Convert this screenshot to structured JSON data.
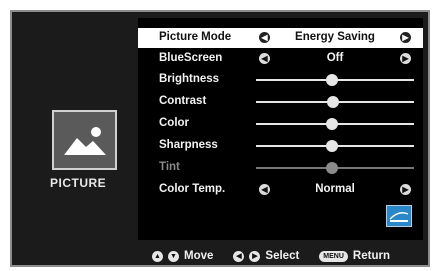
{
  "category": {
    "label": "PICTURE",
    "icon": "picture-icon"
  },
  "menu": {
    "rows": [
      {
        "label": "Picture Mode",
        "type": "selector",
        "value": "Energy Saving",
        "selected": true
      },
      {
        "label": "BlueScreen",
        "type": "selector",
        "value": "Off"
      },
      {
        "label": "Brightness",
        "type": "slider",
        "level": 0.48
      },
      {
        "label": "Contrast",
        "type": "slider",
        "level": 0.49
      },
      {
        "label": "Color",
        "type": "slider",
        "level": 0.48
      },
      {
        "label": "Sharpness",
        "type": "slider",
        "level": 0.48
      },
      {
        "label": "Tint",
        "type": "slider",
        "level": 0.48,
        "disabled": true
      },
      {
        "label": "Color Temp.",
        "type": "selector",
        "value": "Normal"
      }
    ]
  },
  "badge": {
    "icon": "energy-star-icon"
  },
  "footer": {
    "move_label": "Move",
    "select_label": "Select",
    "menu_button": "MENU",
    "return_label": "Return"
  },
  "colors": {
    "panel": "#000000",
    "selected_row": "#ffffff",
    "badge": "#2a88c8"
  }
}
